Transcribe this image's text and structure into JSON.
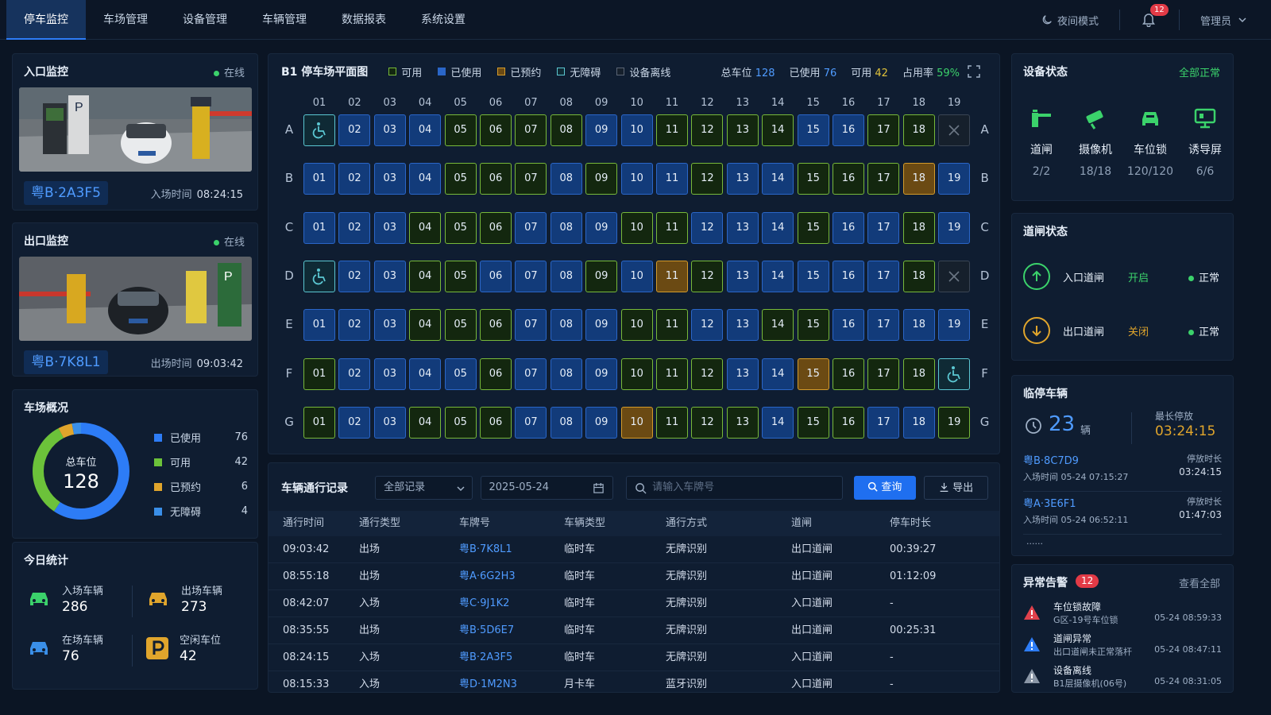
{
  "nav": {
    "items": [
      "停车监控",
      "车场管理",
      "设备管理",
      "车辆管理",
      "数据报表",
      "系统设置"
    ],
    "night_mode": "夜间模式",
    "notif_count": "12",
    "user": "管理员"
  },
  "entrance": {
    "title": "入口监控",
    "status": "在线",
    "plate": "粤B·2A3F5",
    "time_label": "入场时间",
    "time": "08:24:15"
  },
  "exit": {
    "title": "出口监控",
    "status": "在线",
    "plate": "粤B·7K8L1",
    "time_label": "出场时间",
    "time": "09:03:42"
  },
  "overview": {
    "title": "车场概况",
    "center_label": "总车位",
    "total": "128",
    "legend": [
      {
        "label": "已使用",
        "value": "76",
        "color": "#2d7cf6"
      },
      {
        "label": "可用",
        "value": "42",
        "color": "#6cc23a"
      },
      {
        "label": "已预约",
        "value": "6",
        "color": "#e0a52c"
      },
      {
        "label": "无障碍",
        "value": "4",
        "color": "#3a8fe8"
      }
    ]
  },
  "today": {
    "title": "今日统计",
    "items": [
      {
        "label": "入场车辆",
        "value": "286"
      },
      {
        "label": "出场车辆",
        "value": "273"
      },
      {
        "label": "在场车辆",
        "value": "76"
      },
      {
        "label": "空闲车位",
        "value": "42"
      }
    ]
  },
  "map": {
    "title": "B1 停车场平面图",
    "legend": [
      "可用",
      "已使用",
      "已预约",
      "无障碍",
      "设备离线"
    ],
    "stats": [
      {
        "label": "总车位",
        "value": "128",
        "color": "#4f9bff"
      },
      {
        "label": "已使用",
        "value": "76",
        "color": "#4f9bff"
      },
      {
        "label": "可用",
        "value": "42",
        "color": "#e0c23a"
      },
      {
        "label": "占用率",
        "value": "59%",
        "color": "#3bd26b"
      }
    ],
    "cols": [
      "01",
      "02",
      "03",
      "04",
      "05",
      "06",
      "07",
      "08",
      "09",
      "10",
      "11",
      "12",
      "13",
      "14",
      "15",
      "16",
      "17",
      "18",
      "19"
    ],
    "rows": [
      {
        "id": "A",
        "slots": "huuuaaaauuaaaauuaao"
      },
      {
        "id": "B",
        "slots": "uuuuaaauauuauuaaaru"
      },
      {
        "id": "C",
        "slots": "uuuaaauuuaauuuauuau"
      },
      {
        "id": "D",
        "slots": "huuaauuuaurauuuuuao"
      },
      {
        "id": "E",
        "slots": "uuuaaauuuaauuaauuuu"
      },
      {
        "id": "F",
        "slots": "auuuuauuuaaauuraaah"
      },
      {
        "id": "G",
        "slots": "auuaaauuuraaauaauua"
      }
    ]
  },
  "records": {
    "title": "车辆通行记录",
    "filter": "全部记录",
    "date": "2025-05-24",
    "search_placeholder": "请输入车牌号",
    "query": "查询",
    "export": "导出",
    "headers": [
      "通行时间",
      "通行类型",
      "车牌号",
      "车辆类型",
      "通行方式",
      "道闸",
      "停车时长"
    ],
    "rows": [
      [
        "09:03:42",
        "出场",
        "粤B·7K8L1",
        "临时车",
        "无牌识别",
        "出口道闸",
        "00:39:27"
      ],
      [
        "08:55:18",
        "出场",
        "粤A·6G2H3",
        "临时车",
        "无牌识别",
        "出口道闸",
        "01:12:09"
      ],
      [
        "08:42:07",
        "入场",
        "粤C·9J1K2",
        "临时车",
        "无牌识别",
        "入口道闸",
        "-"
      ],
      [
        "08:35:55",
        "出场",
        "粤B·5D6E7",
        "临时车",
        "无牌识别",
        "出口道闸",
        "00:25:31"
      ],
      [
        "08:24:15",
        "入场",
        "粤B·2A3F5",
        "临时车",
        "无牌识别",
        "入口道闸",
        "-"
      ],
      [
        "08:15:33",
        "入场",
        "粤D·1M2N3",
        "月卡车",
        "蓝牙识别",
        "入口道闸",
        "-"
      ]
    ]
  },
  "devices": {
    "title": "设备状态",
    "all_ok": "全部正常",
    "items": [
      {
        "name": "道闸",
        "count": "2/2"
      },
      {
        "name": "摄像机",
        "count": "18/18"
      },
      {
        "name": "车位锁",
        "count": "120/120"
      },
      {
        "name": "诱导屏",
        "count": "6/6"
      }
    ]
  },
  "gates": {
    "title": "道闸状态",
    "items": [
      {
        "name": "入口道闸",
        "state": "开启",
        "status": "正常"
      },
      {
        "name": "出口道闸",
        "state": "关闭",
        "status": "正常"
      }
    ]
  },
  "temp": {
    "title": "临停车辆",
    "count": "23",
    "unit": "辆",
    "longest_label": "最长停放",
    "longest": "03:24:15",
    "vehicles": [
      {
        "plate": "粤B·8C7D9",
        "in_label": "入场时间",
        "in_time": "05-24 07:15:27",
        "dur_label": "停放时长",
        "dur": "03:24:15"
      },
      {
        "plate": "粤A·3E6F1",
        "in_label": "入场时间",
        "in_time": "05-24 06:52:11",
        "dur_label": "停放时长",
        "dur": "01:47:03"
      }
    ],
    "more": "......"
  },
  "alarms": {
    "title": "异常告警",
    "count": "12",
    "view_all": "查看全部",
    "items": [
      {
        "title": "车位锁故障",
        "desc": "G区-19号车位锁",
        "time": "05-24 08:59:33",
        "color": "#e0414c"
      },
      {
        "title": "道闸异常",
        "desc": "出口道闸未正常落杆",
        "time": "05-24 08:47:11",
        "color": "#2d7cf6"
      },
      {
        "title": "设备离线",
        "desc": "B1层摄像机(06号)",
        "time": "05-24 08:31:05",
        "color": "#8a96a6"
      }
    ]
  }
}
